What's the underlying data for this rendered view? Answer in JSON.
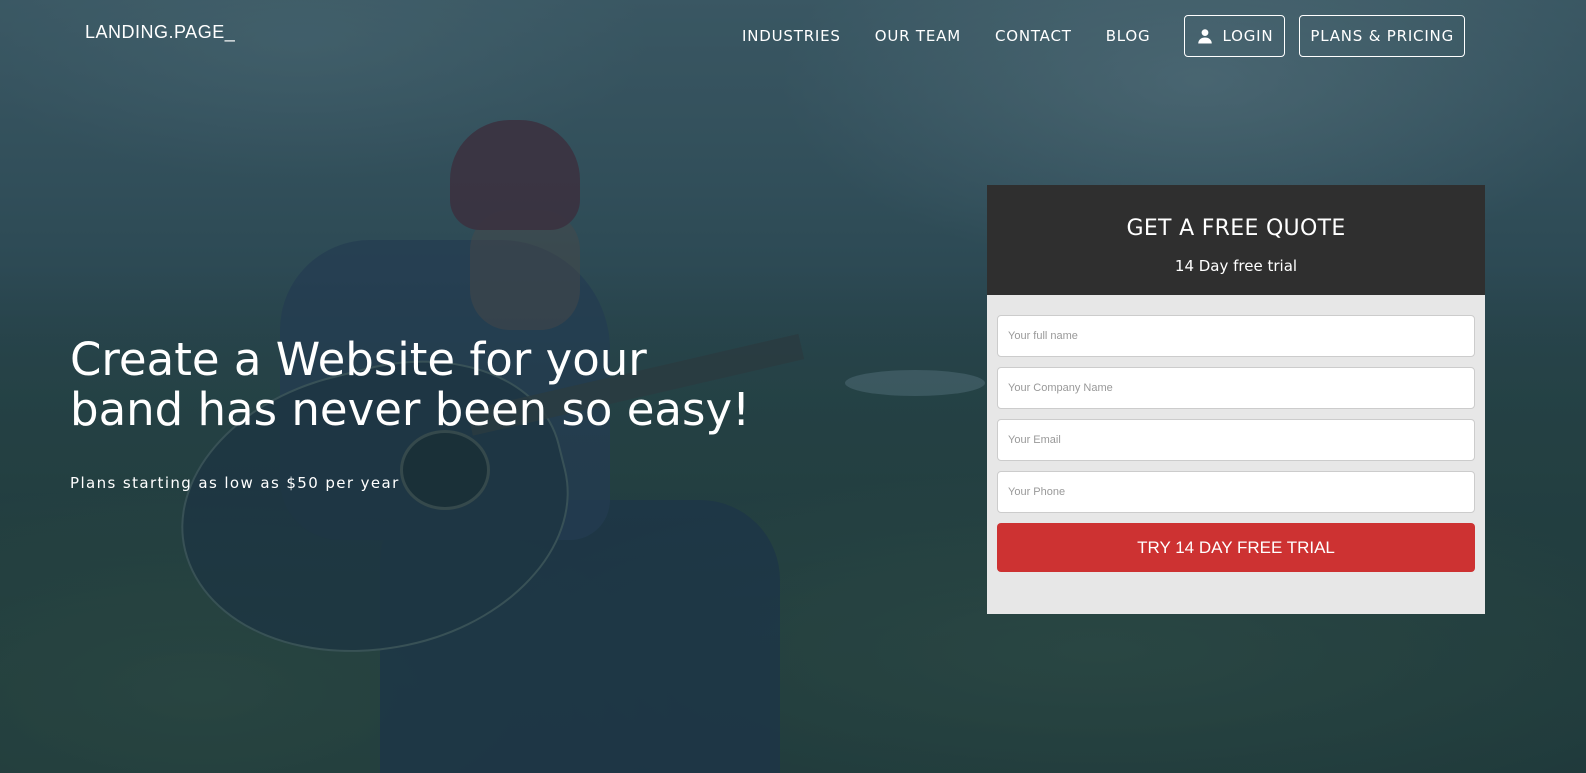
{
  "header": {
    "logo": "LANDING.PAGE_",
    "nav": [
      "INDUSTRIES",
      "OUR TEAM",
      "CONTACT",
      "BLOG"
    ],
    "login_label": "LOGIN",
    "pricing_label": "PLANS & PRICING",
    "login_icon": "user-icon"
  },
  "hero": {
    "headline_line1": "Create a Website for your",
    "headline_line2": "band has never been so easy!",
    "subline": "Plans starting as low as $50 per year"
  },
  "quote": {
    "title": "GET A FREE QUOTE",
    "subtitle": "14 Day free trial",
    "placeholders": {
      "name": "Your full name",
      "company": "Your Company Name",
      "email": "Your Email",
      "phone": "Your Phone"
    },
    "submit_label": "TRY 14 DAY FREE TRIAL"
  },
  "colors": {
    "accent": "#cd3232",
    "form_header": "#2f2f2f",
    "form_body": "#e7e7e7"
  }
}
